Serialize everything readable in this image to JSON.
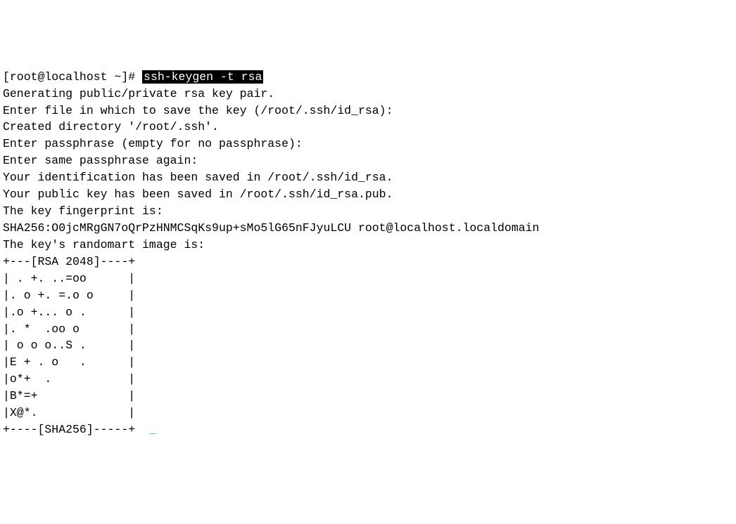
{
  "prompt": "[root@localhost ~]# ",
  "command": "ssh-keygen -t rsa",
  "lines": {
    "l0a": "Generating public/private rsa key p",
    "l0b": "r.",
    "l1": "Enter file in which to save the key (/root/.ssh/id_rsa):",
    "l2": "Created directory '/root/.ssh'.",
    "l3": "Enter passphrase (empty for no passphrase):",
    "l4": "Enter same passphrase again:",
    "l5": "Your identification has been saved in /root/.ssh/id_rsa.",
    "l6": "Your public key has been saved in /root/.ssh/id_rsa.pub.",
    "l7": "The key fingerprint is:",
    "l8": "SHA256:O0jcMRgGN7oQrPzHNMCSqKs9up+sMo5lG65nFJyuLCU root@localhost.localdomain",
    "l9": "The key's randomart image is:"
  },
  "randomart": [
    "+---[RSA 2048]----+",
    "| . +. ..=oo      |",
    "|. o +. =.o o     |",
    "|.o +... o .      |",
    "|. *  .oo o       |",
    "| o o o..S .      |",
    "|E + . o   .      |",
    "|o*+  .           |",
    "|B*=+             |",
    "|X@*.             |",
    "+----[SHA256]-----+"
  ],
  "cursor": "_"
}
